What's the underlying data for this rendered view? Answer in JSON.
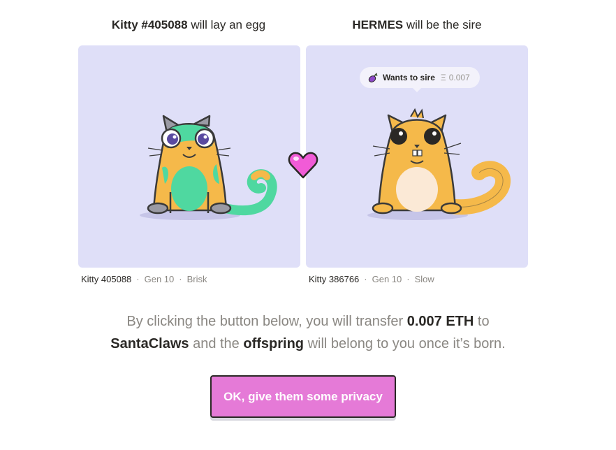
{
  "left": {
    "heading_name": "Kitty #405088",
    "heading_rest": "will lay an egg",
    "kitty_id": "Kitty 405088",
    "gen": "Gen 10",
    "speed": "Brisk",
    "separator": "·"
  },
  "right": {
    "heading_name": "HERMES",
    "heading_rest": "will be the sire",
    "kitty_id": "Kitty 386766",
    "gen": "Gen 10",
    "speed": "Slow",
    "separator": "·",
    "bubble": {
      "label": "Wants to sire",
      "currency_symbol": "Ξ",
      "amount": "0.007",
      "icon": "eggplant-icon"
    }
  },
  "heart_icon": "heart-icon",
  "description": {
    "part1": "By clicking the button below, you will transfer",
    "amount": "0.007 ETH",
    "part2": "to",
    "owner": "SantaClaws",
    "part3": "and the",
    "offspring": "offspring",
    "part4": "will belong to you once it’s born."
  },
  "cta_label": "OK, give them some privacy",
  "colors": {
    "card_bg": "#dfdff8",
    "button": "#e57ad7",
    "heart": "#f15bd7",
    "text_dark": "#2a2825",
    "text_muted": "#8a8782"
  }
}
